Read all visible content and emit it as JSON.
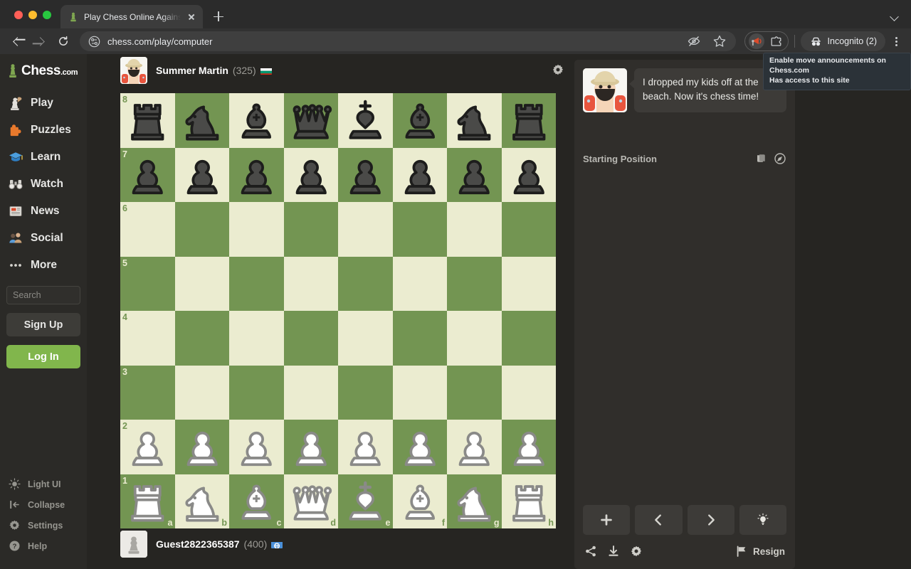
{
  "browser": {
    "tab": {
      "title": "Play Chess Online Against the",
      "favicon": "chess-pawn-icon"
    },
    "url": "chess.com/play/computer",
    "incognito_label": "Incognito (2)",
    "tooltip_line1": "Enable move announcements on Chess.com",
    "tooltip_line2": "Has access to this site",
    "icons": {
      "back": "back-arrow-icon",
      "forward": "forward-arrow-icon",
      "reload": "reload-icon",
      "site_info": "site-settings-icon",
      "hide_password": "eye-slash-icon",
      "bookmark": "star-icon",
      "extension_active": "megaphone-extension-icon",
      "extensions": "extensions-puzzle-icon",
      "profile": "incognito-icon",
      "menu": "kebab-menu-icon",
      "tab_search": "chevron-down-icon",
      "new_tab": "plus-icon",
      "tab_close": "close-icon"
    }
  },
  "sidebar": {
    "brand": "Chess",
    "brand_suffix": ".com",
    "items": [
      {
        "label": "Play",
        "icon": "play-pawn-icon"
      },
      {
        "label": "Puzzles",
        "icon": "puzzle-piece-icon"
      },
      {
        "label": "Learn",
        "icon": "graduation-cap-icon"
      },
      {
        "label": "Watch",
        "icon": "binoculars-icon"
      },
      {
        "label": "News",
        "icon": "newspaper-icon"
      },
      {
        "label": "Social",
        "icon": "people-icon"
      },
      {
        "label": "More",
        "icon": "ellipsis-icon"
      }
    ],
    "search_placeholder": "Search",
    "signup_label": "Sign Up",
    "login_label": "Log In",
    "bottom_items": [
      {
        "label": "Light UI",
        "icon": "sun-icon"
      },
      {
        "label": "Collapse",
        "icon": "collapse-arrow-icon"
      },
      {
        "label": "Settings",
        "icon": "gear-icon"
      },
      {
        "label": "Help",
        "icon": "question-circle-icon"
      }
    ]
  },
  "game": {
    "top_player": {
      "name": "Summer Martin",
      "rating": "(325)",
      "flag": "bulgaria-flag-icon",
      "avatar": "summer-martin-avatar"
    },
    "bottom_player": {
      "name": "Guest2822365387",
      "rating": "(400)",
      "flag": "international-flag-icon",
      "avatar": "guest-pawn-avatar"
    },
    "settings_icon": "gear-icon",
    "board": {
      "light_color": "#ebecd0",
      "dark_color": "#739552",
      "orientation": "white",
      "ranks": [
        "8",
        "7",
        "6",
        "5",
        "4",
        "3",
        "2",
        "1"
      ],
      "files": [
        "a",
        "b",
        "c",
        "d",
        "e",
        "f",
        "g",
        "h"
      ],
      "position": [
        [
          "br",
          "bn",
          "bb",
          "bq",
          "bk",
          "bb",
          "bn",
          "br"
        ],
        [
          "bp",
          "bp",
          "bp",
          "bp",
          "bp",
          "bp",
          "bp",
          "bp"
        ],
        [
          "",
          "",
          "",
          "",
          "",
          "",
          "",
          ""
        ],
        [
          "",
          "",
          "",
          "",
          "",
          "",
          "",
          ""
        ],
        [
          "",
          "",
          "",
          "",
          "",
          "",
          "",
          ""
        ],
        [
          "",
          "",
          "",
          "",
          "",
          "",
          "",
          ""
        ],
        [
          "wp",
          "wp",
          "wp",
          "wp",
          "wp",
          "wp",
          "wp",
          "wp"
        ],
        [
          "wr",
          "wn",
          "wb",
          "wq",
          "wk",
          "wb",
          "wn",
          "wr"
        ]
      ]
    }
  },
  "panel": {
    "chat_message": "I dropped my kids off at the beach. Now it's chess time!",
    "chat_avatar": "summer-martin-avatar",
    "status_text": "Starting Position",
    "status_icons": [
      {
        "name": "opening-book-icon"
      },
      {
        "name": "compass-icon"
      }
    ],
    "controls": [
      {
        "name": "new-game-button",
        "icon": "plus-icon"
      },
      {
        "name": "previous-move-button",
        "icon": "chevron-left-icon"
      },
      {
        "name": "next-move-button",
        "icon": "chevron-right-icon"
      },
      {
        "name": "hint-button",
        "icon": "lightbulb-icon"
      }
    ],
    "footer_icons": [
      {
        "name": "share-button",
        "icon": "share-icon"
      },
      {
        "name": "download-button",
        "icon": "download-icon"
      },
      {
        "name": "game-settings-button",
        "icon": "gear-icon"
      }
    ],
    "resign_label": "Resign",
    "resign_icon": "flag-icon"
  },
  "colors": {
    "accent_green": "#81b64c",
    "board_dark": "#739552",
    "board_light": "#ebecd0",
    "page_bg": "#262522",
    "panel_bg": "#302e2b"
  }
}
